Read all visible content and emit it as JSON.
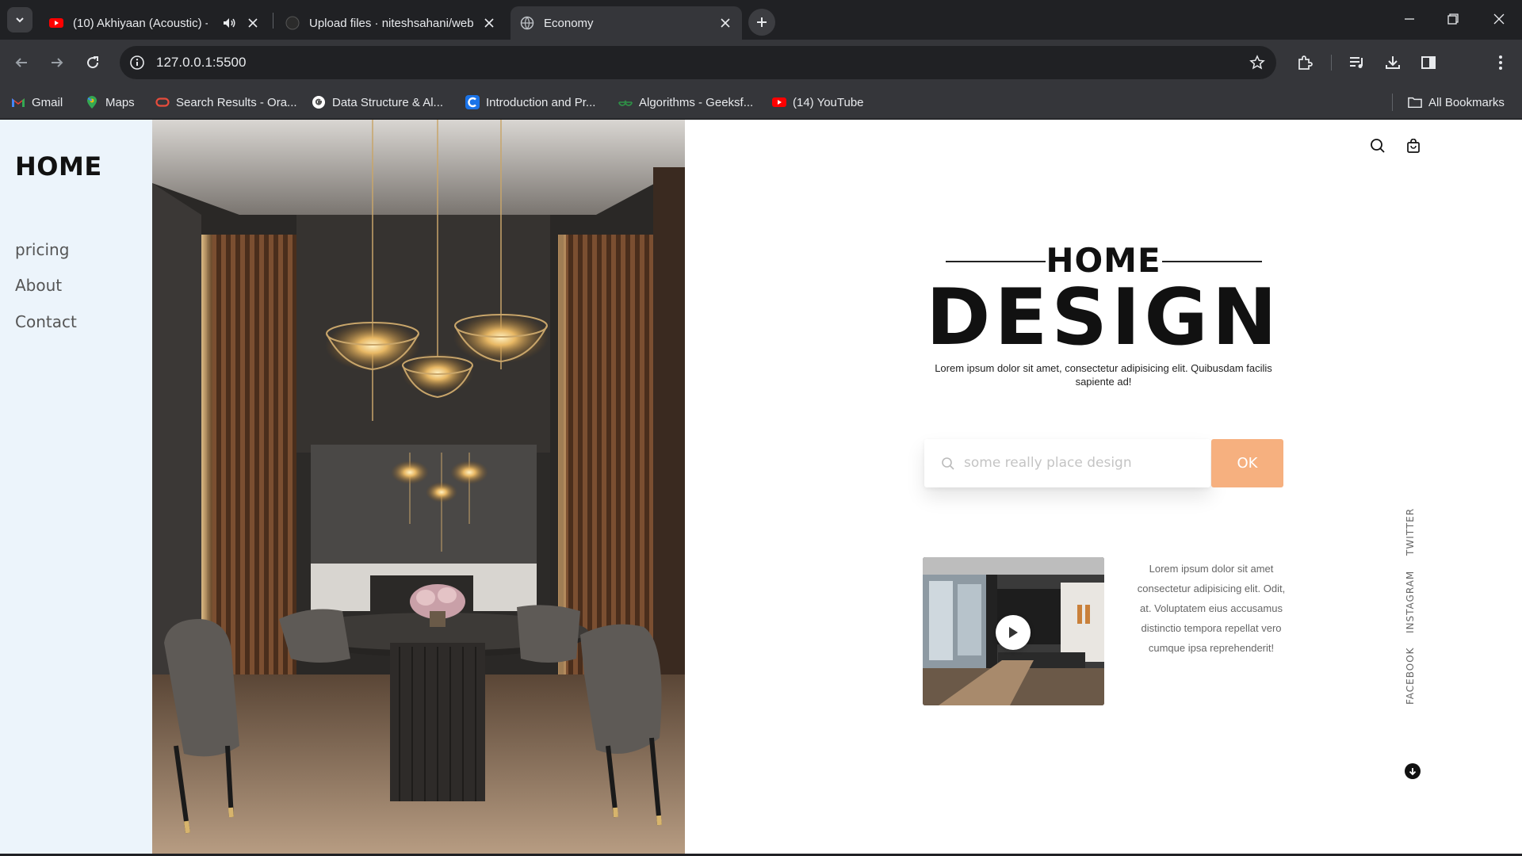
{
  "browser": {
    "tabs": [
      {
        "title": "(10) Akhiyaan (Acoustic) - YouTube",
        "favicon": "youtube-icon",
        "audio": true,
        "active": false
      },
      {
        "title": "Upload files · niteshsahani/web",
        "favicon": "github-icon",
        "active": false
      },
      {
        "title": "Economy",
        "favicon": "globe-icon",
        "active": true
      }
    ],
    "url": "127.0.0.1:5500",
    "bookmarks": [
      {
        "label": "Gmail",
        "icon": "gmail-icon"
      },
      {
        "label": "Maps",
        "icon": "maps-icon"
      },
      {
        "label": "Search Results - Ora...",
        "icon": "oracle-icon"
      },
      {
        "label": "Data Structure & Al...",
        "icon": "google-icon"
      },
      {
        "label": "Introduction and Pr...",
        "icon": "codechef-icon"
      },
      {
        "label": "Algorithms - Geeksf...",
        "icon": "gfg-icon"
      },
      {
        "label": "(14) YouTube",
        "icon": "youtube-icon"
      }
    ],
    "all_bookmarks": "All Bookmarks"
  },
  "page": {
    "logo": "HOME",
    "nav": [
      "pricing",
      "About",
      "Contact"
    ],
    "hero": {
      "kicker": "HOME",
      "headline": "DESIGN",
      "lead": "Lorem ipsum dolor sit amet, consectetur adipisicing elit. Quibusdam facilis sapiente ad!"
    },
    "search": {
      "placeholder": "some really place design",
      "button": "OK"
    },
    "video_text": "Lorem ipsum dolor sit amet consectetur adipisicing elit. Odit, at. Voluptatem eius accusamus distinctio tempora repellat vero cumque ipsa reprehenderit!",
    "social": [
      "TWITTER",
      "INSTAGRAM",
      "FACEBOOK"
    ]
  },
  "colors": {
    "accent": "#f6b07f",
    "sidebar": "#ecf4fb",
    "chrome_dark": "#202124",
    "chrome_toolbar": "#35363a"
  }
}
